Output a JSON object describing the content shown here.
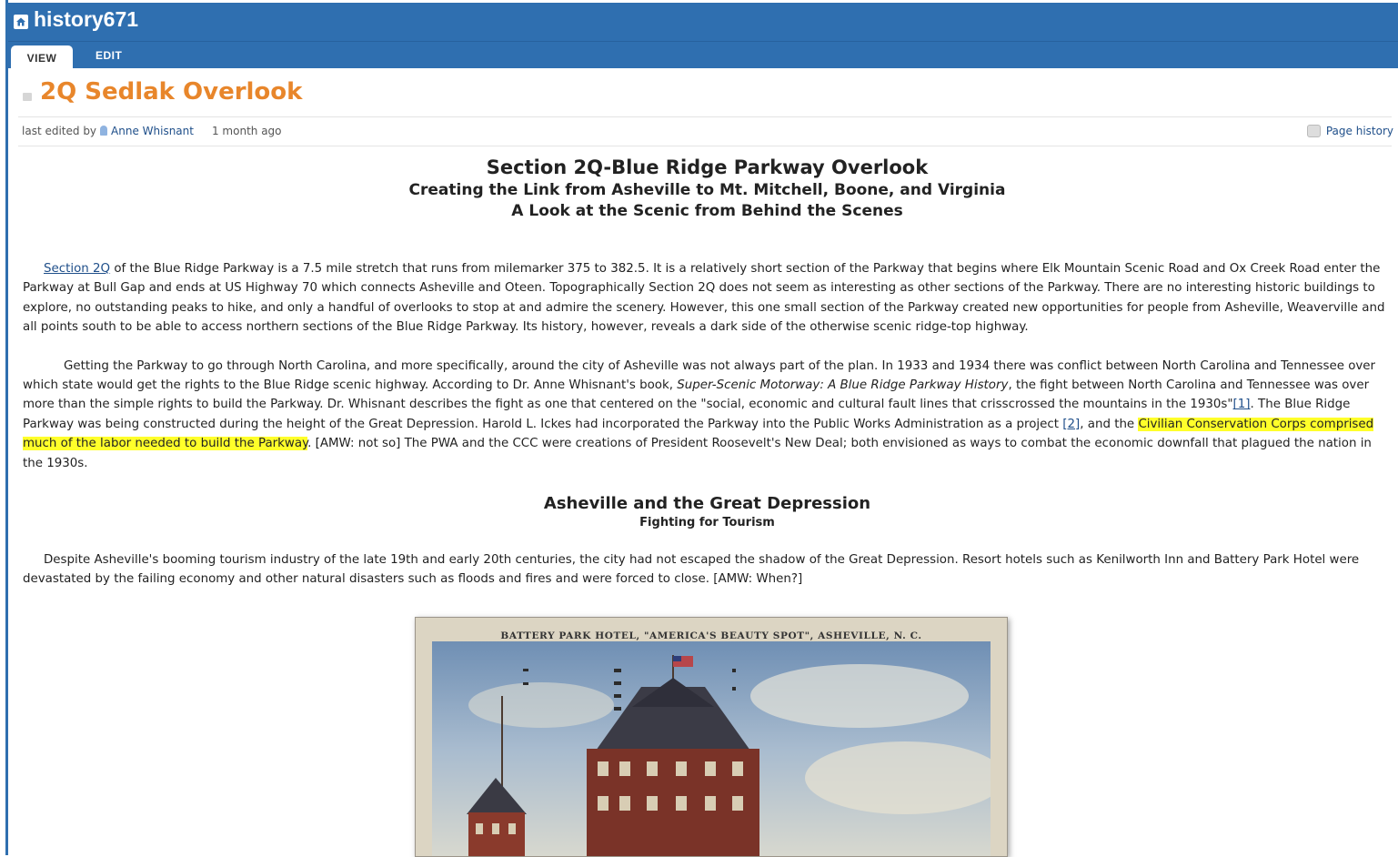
{
  "app": {
    "title": "history671"
  },
  "tabs": [
    {
      "label": "VIEW"
    },
    {
      "label": "EDIT"
    }
  ],
  "page": {
    "title": "2Q Sedlak Overlook",
    "meta_prefix": "last edited by",
    "author": "Anne Whisnant",
    "time_ago": "1 month ago",
    "history_label": "Page history"
  },
  "article": {
    "heading": "Section 2Q-Blue Ridge Parkway Overlook",
    "subheading": "Creating the Link from Asheville to Mt. Mitchell, Boone, and Virginia",
    "subheading2": "A Look at the Scenic from Behind the Scenes",
    "p1_link": "Section 2Q",
    "p1": " of the Blue Ridge Parkway is a 7.5 mile stretch that runs from milemarker 375 to 382.5.  It is a relatively short section of the Parkway that begins where Elk Mountain Scenic Road and Ox Creek Road enter the Parkway at Bull Gap and ends at US Highway 70 which connects Asheville and Oteen.  Topographically Section 2Q does not seem as interesting as other sections of the Parkway.  There are no interesting historic buildings to explore, no outstanding peaks to hike, and only a handful of overlooks to stop at and admire the scenery.  However, this one small section of the Parkway created new opportunities for people from Asheville, Weaverville and all points south to be able to access northern sections of the Blue Ridge Parkway.  Its history, however, reveals a dark side of the otherwise scenic ridge-top highway.",
    "p2_a": "Getting the Parkway to go through North Carolina, and more specifically, around the city of Asheville was not always part of the plan.  In 1933 and 1934 there was conflict between  North Carolina and Tennessee over which state would get the rights to the Blue Ridge scenic highway.  According to Dr. Anne Whisnant's book, ",
    "p2_book": "Super-Scenic Motorway: A Blue Ridge Parkway History",
    "p2_b": ", the fight between North Carolina and Tennessee was over more than the simple rights to build the Parkway.  Dr. Whisnant describes the fight as one that centered on the \"social, economic and cultural fault lines that crisscrossed the mountains in the 1930s\"",
    "p2_ref1": "[1]",
    "p2_c": ".  The Blue Ridge Parkway was being constructed during the height of the Great Depression.  Harold L. Ickes had incorporated the Parkway into the Public Works Administration as a project ",
    "p2_ref2": "[2]",
    "p2_d": ", and the ",
    "p2_highlight": "Civilian Conservation Corps comprised much of the labor needed to build the Parkway",
    "p2_e": ". [AMW: not so] The PWA and the CCC were creations of President Roosevelt's New Deal; both envisioned as ways to combat the economic downfall that plagued the nation in the 1930s.",
    "section_title": "Asheville and the Great Depression",
    "section_subtitle": "Fighting for Tourism",
    "p3": "Despite Asheville's booming tourism industry of the late 19th and early 20th centuries, the city had not escaped the shadow of the Great Depression.  Resort hotels such as Kenilworth Inn and Battery Park Hotel were devastated by the failing economy and other natural disasters such as floods and fires and were forced to close. [AMW: When?]",
    "image_caption": "BATTERY PARK HOTEL, \"AMERICA'S BEAUTY SPOT\", ASHEVILLE, N. C."
  },
  "colors": {
    "header_blue": "#2f6fb0",
    "title_orange": "#e8862b",
    "link_blue": "#1f4f8a",
    "highlight": "#ffff2a"
  }
}
